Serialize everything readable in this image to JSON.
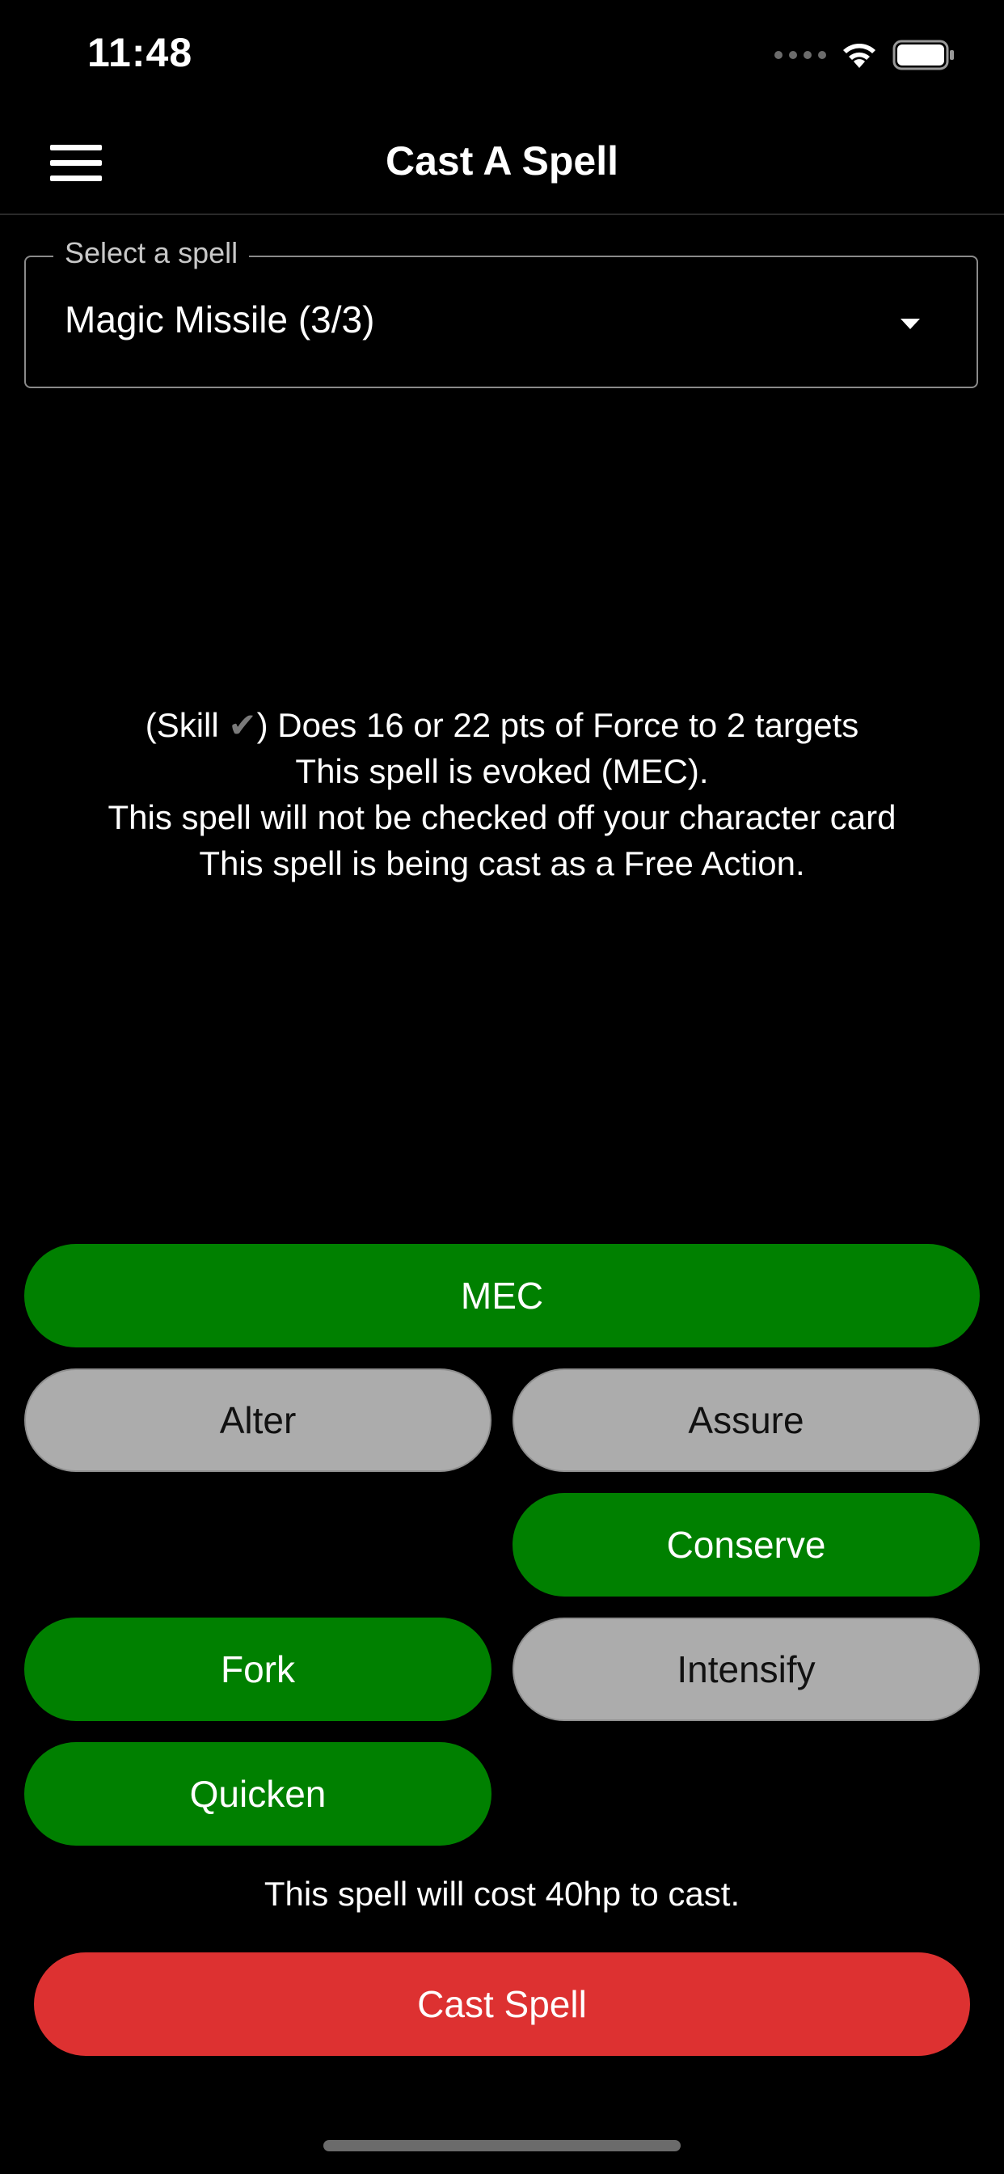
{
  "status_bar": {
    "time": "11:48",
    "icons": [
      "signal-dots-icon",
      "wifi-icon",
      "battery-icon"
    ]
  },
  "header": {
    "menu_icon": "hamburger-menu-icon",
    "title": "Cast A Spell"
  },
  "spell_select": {
    "label": "Select a spell",
    "value": "Magic Missile (3/3)",
    "icon": "dropdown-arrow-icon"
  },
  "description": {
    "line1_prefix": "(Skill ",
    "line1_check": "✔",
    "line1_suffix": ") Does 16 or 22 pts of Force to 2 targets",
    "line2": "This spell is evoked (MEC).",
    "line3": "This spell will not be checked off your character card",
    "line4": "This spell is being cast as a Free Action."
  },
  "modifiers": {
    "mec": {
      "label": "MEC",
      "active": true
    },
    "alter": {
      "label": "Alter",
      "active": false
    },
    "assure": {
      "label": "Assure",
      "active": false
    },
    "conserve": {
      "label": "Conserve",
      "active": true
    },
    "fork": {
      "label": "Fork",
      "active": true
    },
    "intensify": {
      "label": "Intensify",
      "active": false
    },
    "quicken": {
      "label": "Quicken",
      "active": true
    }
  },
  "cost_text": "This spell will cost 40hp to cast.",
  "cast_button": {
    "label": "Cast Spell"
  },
  "colors": {
    "active": "#008000",
    "inactive": "#acacac",
    "cast": "#dd3131",
    "background": "#000000"
  }
}
